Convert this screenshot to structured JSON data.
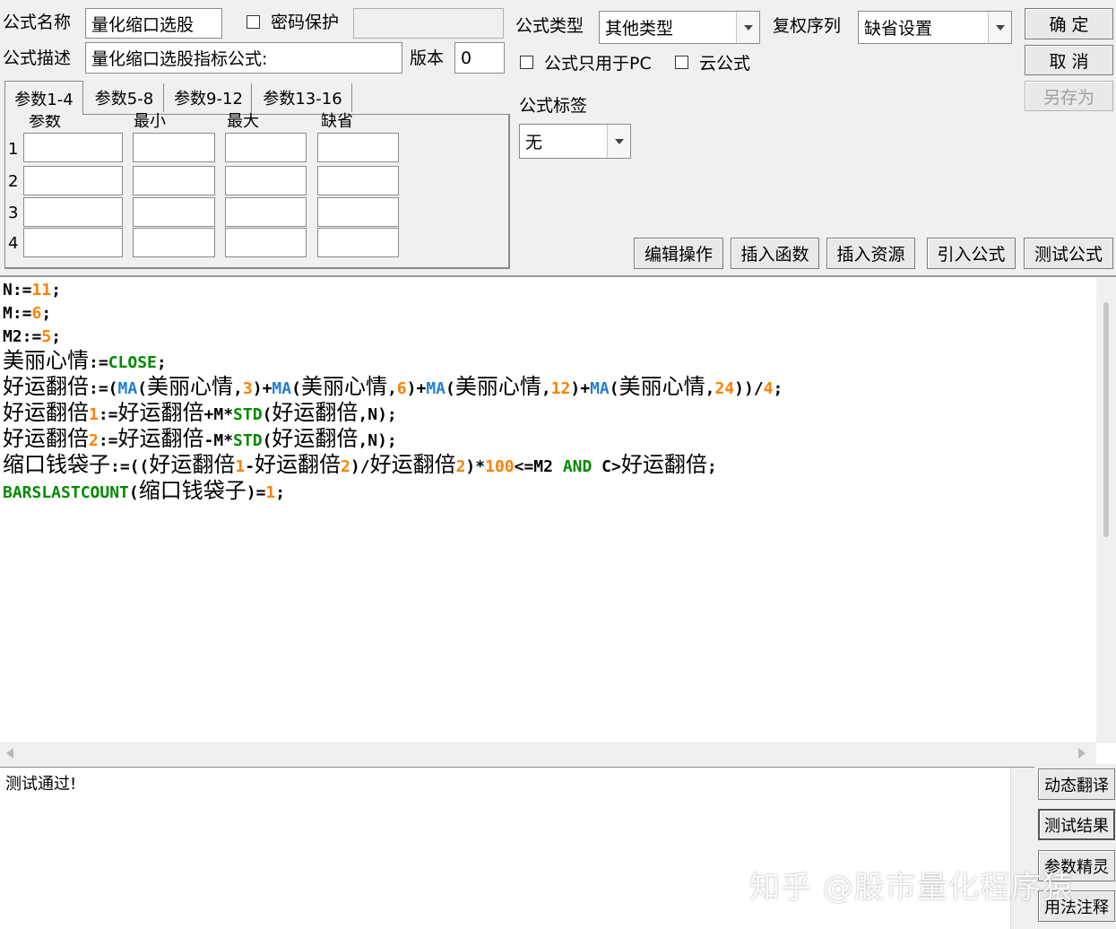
{
  "header": {
    "name_label": "公式名称",
    "name_value": "量化缩口选股",
    "password_label": "密码保护",
    "desc_label": "公式描述",
    "desc_value": "量化缩口选股指标公式:",
    "version_label": "版本",
    "version_value": "0",
    "type_label": "公式类型",
    "type_value": "其他类型",
    "rights_label": "复权序列",
    "rights_value": "缺省设置",
    "pc_only_label": "公式只用于PC",
    "cloud_label": "云公式",
    "tag_label": "公式标签",
    "tag_value": "无"
  },
  "buttons": {
    "ok": "确 定",
    "cancel": "取 消",
    "save_as": "另存为",
    "edit_ops": "编辑操作",
    "insert_func": "插入函数",
    "insert_res": "插入资源",
    "import_formula": "引入公式",
    "test_formula": "测试公式",
    "dynamic_translate": "动态翻译",
    "test_result": "测试结果",
    "param_wizard": "参数精灵",
    "usage_notes": "用法注释"
  },
  "tabs": [
    "参数1-4",
    "参数5-8",
    "参数9-12",
    "参数13-16"
  ],
  "params": {
    "headers": [
      "参数",
      "最小",
      "最大",
      "缺省"
    ],
    "rows": [
      "1",
      "2",
      "3",
      "4"
    ]
  },
  "code_lines": [
    "N:=11;",
    "M:=6;",
    "M2:=5;",
    "美丽心情:=CLOSE;",
    "好运翻倍:=(MA(美丽心情,3)+MA(美丽心情,6)+MA(美丽心情,12)+MA(美丽心情,24))/4;",
    "好运翻倍1:=好运翻倍+M*STD(好运翻倍,N);",
    "好运翻倍2:=好运翻倍-M*STD(好运翻倍,N);",
    "缩口钱袋子:=((好运翻倍1-好运翻倍2)/好运翻倍2)*100<=M2 AND C>好运翻倍;",
    "BARSLASTCOUNT(缩口钱袋子)=1;"
  ],
  "output_text": "测试通过!",
  "watermark": "知乎 @股市量化程序猿",
  "colors": {
    "number": "#ff8000",
    "function": "#008a00",
    "ma_function": "#1e7fd6"
  }
}
